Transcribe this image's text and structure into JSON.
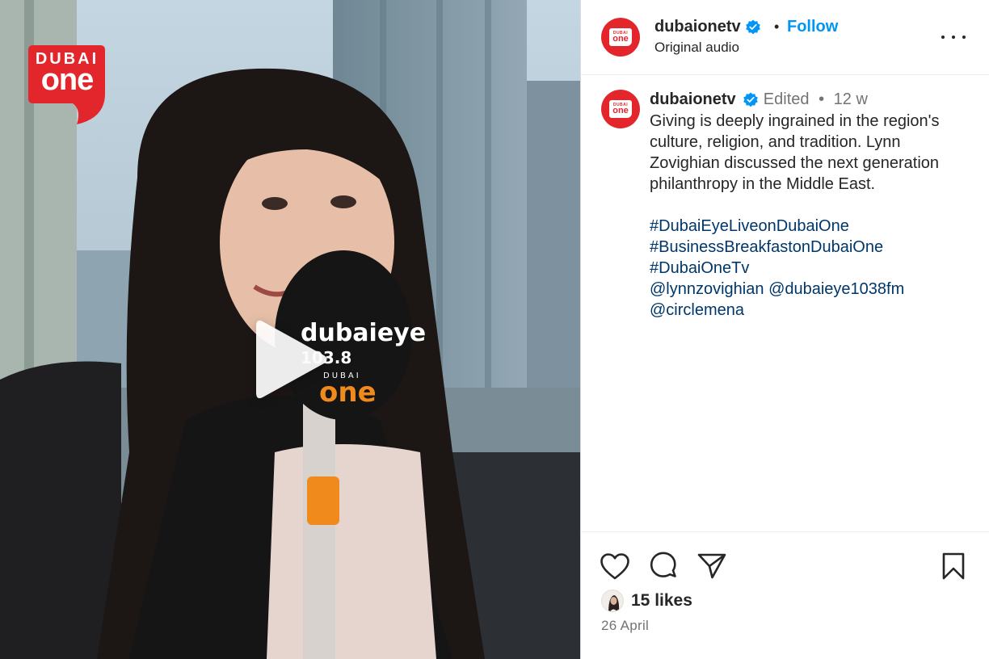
{
  "video": {
    "watermark_top": "DUBAI",
    "watermark_bottom": "one",
    "mic_brand": "dubaieye",
    "mic_freq": "103.8",
    "mic_top": "DUBAI",
    "mic_bottom": "one"
  },
  "header": {
    "avatar_top": "DUBAI",
    "avatar_main": "one",
    "username": "dubaionetv",
    "separator": "•",
    "follow_label": "Follow",
    "audio_label": "Original audio"
  },
  "caption": {
    "avatar_top": "DUBAI",
    "avatar_main": "one",
    "username": "dubaionetv",
    "edited": "Edited",
    "separator": "•",
    "age": "12 w",
    "text": "Giving is deeply ingrained in the region's culture, religion, and tradition. Lynn Zovighian discussed the next generation philanthropy in the Middle East.",
    "hashtags": [
      "#DubaiEyeLiveonDubaiOne",
      "#BusinessBreakfastonDubaiOne",
      "#DubaiOneTv"
    ],
    "mentions": [
      "@lynnzovighian",
      "@dubaieye1038fm",
      "@circlemena"
    ]
  },
  "actions": {
    "likes": "15 likes",
    "date": "26 April"
  },
  "colors": {
    "brand_red": "#e3262b",
    "follow_blue": "#0095f6",
    "link_blue": "#00376b",
    "verified_blue": "#0095f6",
    "muted_text": "#737373"
  },
  "icons": [
    "play-icon",
    "verified-icon",
    "more-icon",
    "heart-icon",
    "comment-icon",
    "share-icon",
    "bookmark-icon"
  ]
}
